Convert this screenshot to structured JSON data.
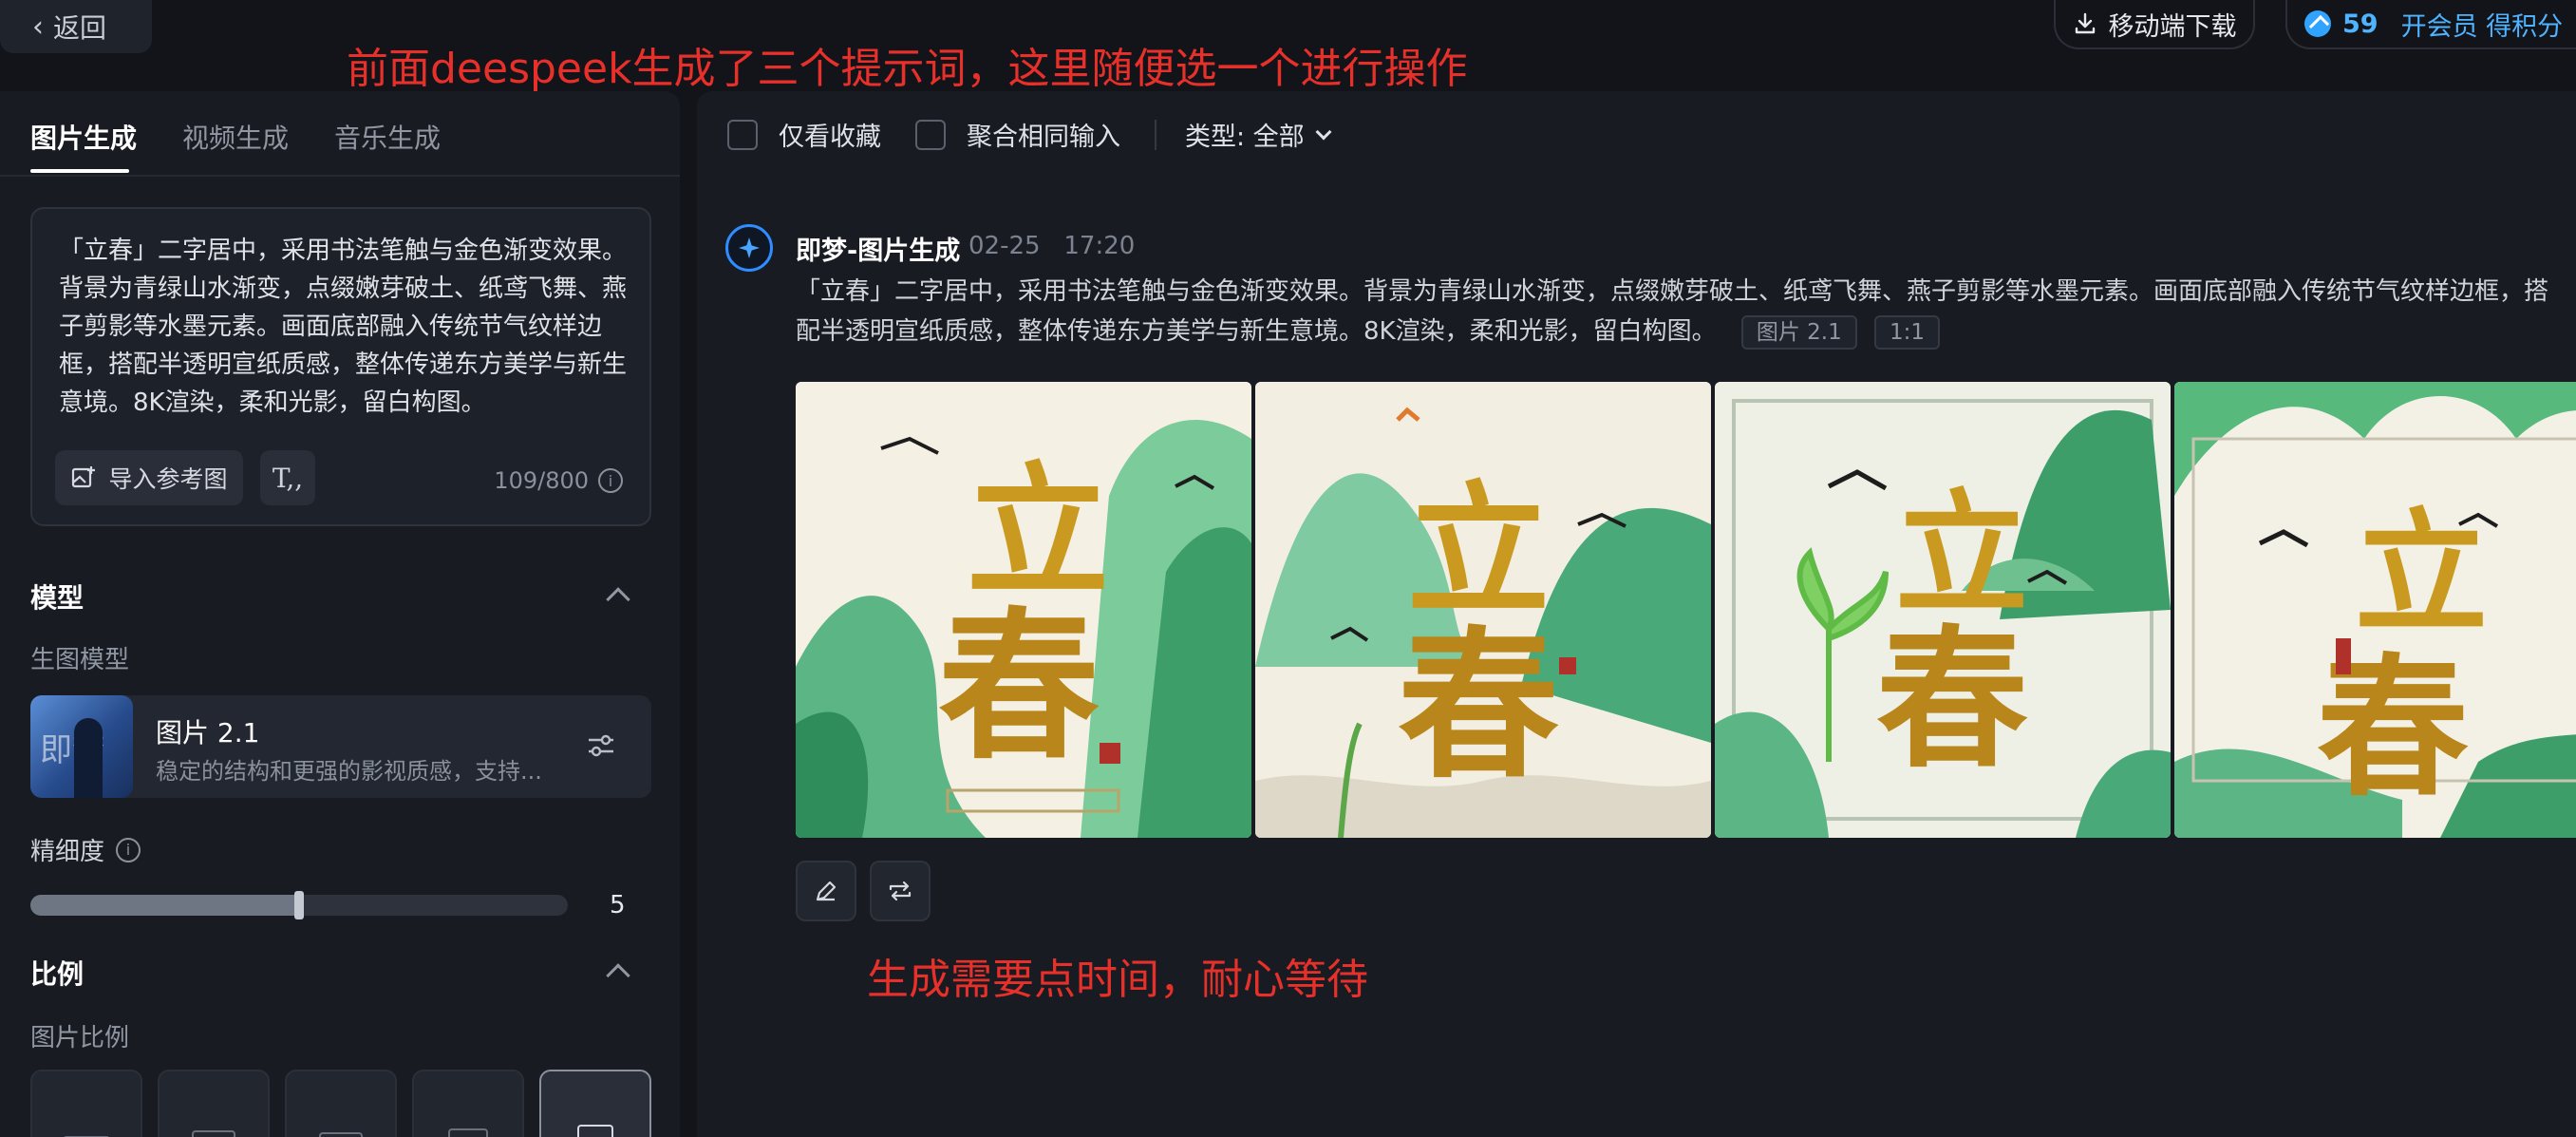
{
  "top": {
    "back_label": "返回",
    "download_label": "移动端下载",
    "credits": "59",
    "vip_label": "开会员 得积分"
  },
  "annotations": {
    "top": "前面deespeek生成了三个提示词，这里随便选一个进行操作",
    "middle": "生成需要点时间，耐心等待"
  },
  "left": {
    "tabs": [
      {
        "label": "图片生成",
        "active": true
      },
      {
        "label": "视频生成",
        "active": false
      },
      {
        "label": "音乐生成",
        "active": false
      }
    ],
    "prompt": "「立春」二字居中，采用书法笔触与金色渐变效果。背景为青绿山水渐变，点缀嫩芽破土、纸鸢飞舞、燕子剪影等水墨元素。画面底部融入传统节气纹样边框，搭配半透明宣纸质感，整体传递东方美学与新生意境。8K渲染，柔和光影，留白构图。",
    "ref_button": "导入参考图",
    "counter": "109/800",
    "model_section": "模型",
    "model_sub": "生图模型",
    "model": {
      "thumb_text": "即梦",
      "name": "图片 2.1",
      "desc": "稳定的结构和更强的影视质感，支持..."
    },
    "precision_label": "精细度",
    "precision_value": "5",
    "precision_fraction": 0.5,
    "ratio_section": "比例",
    "ratio_sub": "图片比例"
  },
  "right": {
    "filters": {
      "favorites": "仅看收藏",
      "merge": "聚合相同输入",
      "type": "类型: 全部"
    },
    "generation": {
      "title": "即梦-图片生成",
      "date": "02-25",
      "time": "17:20",
      "prompt": "「立春」二字居中，采用书法笔触与金色渐变效果。背景为青绿山水渐变，点缀嫩芽破土、纸鸢飞舞、燕子剪影等水墨元素。画面底部融入传统节气纹样边框，搭配半透明宣纸质感，整体传递东方美学与新生意境。8K渲染，柔和光影，留白构图。",
      "tag_model": "图片 2.1",
      "tag_ratio": "1:1",
      "image_text": [
        "立",
        "春"
      ]
    }
  },
  "colors": {
    "accent": "#4fb3ff",
    "annotation": "#e8302a",
    "gold": "#c99a1f",
    "green": "#3fa66d"
  }
}
